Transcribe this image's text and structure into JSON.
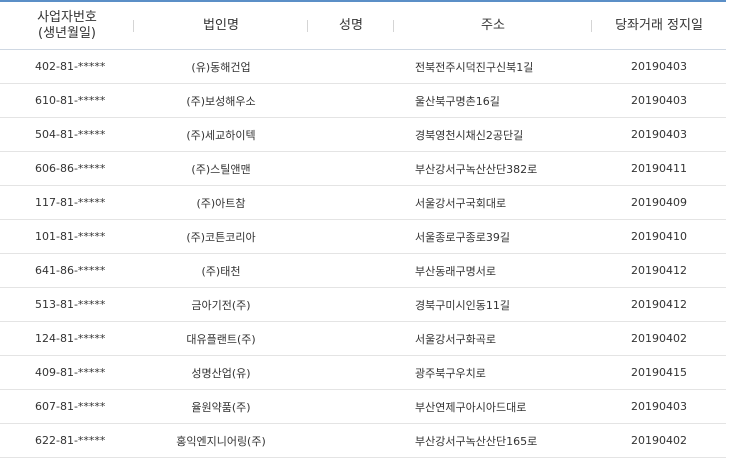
{
  "headers": {
    "brn": "사업자번호\n(생년월일)",
    "brn_line1": "사업자번호",
    "brn_line2": "(생년월일)",
    "corp": "법인명",
    "name": "성명",
    "addr": "주소",
    "date": "당좌거래 정지일"
  },
  "rows": [
    {
      "brn": "402-81-*****",
      "corp": "(유)동해건업",
      "name": "",
      "addr": "전북전주시덕진구신북1길",
      "date": "20190403"
    },
    {
      "brn": "610-81-*****",
      "corp": "(주)보성해우소",
      "name": "",
      "addr": "울산북구명촌16길",
      "date": "20190403"
    },
    {
      "brn": "504-81-*****",
      "corp": "(주)세교하이텍",
      "name": "",
      "addr": "경북영천시채신2공단길",
      "date": "20190403"
    },
    {
      "brn": "606-86-*****",
      "corp": "(주)스틸앤맨",
      "name": "",
      "addr": "부산강서구녹산산단382로",
      "date": "20190411"
    },
    {
      "brn": "117-81-*****",
      "corp": "(주)아트참",
      "name": "",
      "addr": "서울강서구국회대로",
      "date": "20190409"
    },
    {
      "brn": "101-81-*****",
      "corp": "(주)코튼코리아",
      "name": "",
      "addr": "서울종로구종로39길",
      "date": "20190410"
    },
    {
      "brn": "641-86-*****",
      "corp": "(주)태천",
      "name": "",
      "addr": "부산동래구명서로",
      "date": "20190412"
    },
    {
      "brn": "513-81-*****",
      "corp": "금아기전(주)",
      "name": "",
      "addr": "경북구미시인동11길",
      "date": "20190412"
    },
    {
      "brn": "124-81-*****",
      "corp": "대유플랜트(주)",
      "name": "",
      "addr": "서울강서구화곡로",
      "date": "20190402"
    },
    {
      "brn": "409-81-*****",
      "corp": "성명산업(유)",
      "name": "",
      "addr": "광주북구우치로",
      "date": "20190415"
    },
    {
      "brn": "607-81-*****",
      "corp": "율원약품(주)",
      "name": "",
      "addr": "부산연제구아시아드대로",
      "date": "20190403"
    },
    {
      "brn": "622-81-*****",
      "corp": "홍익엔지니어링(주)",
      "name": "",
      "addr": "부산강서구녹산산단165로",
      "date": "20190402"
    }
  ]
}
